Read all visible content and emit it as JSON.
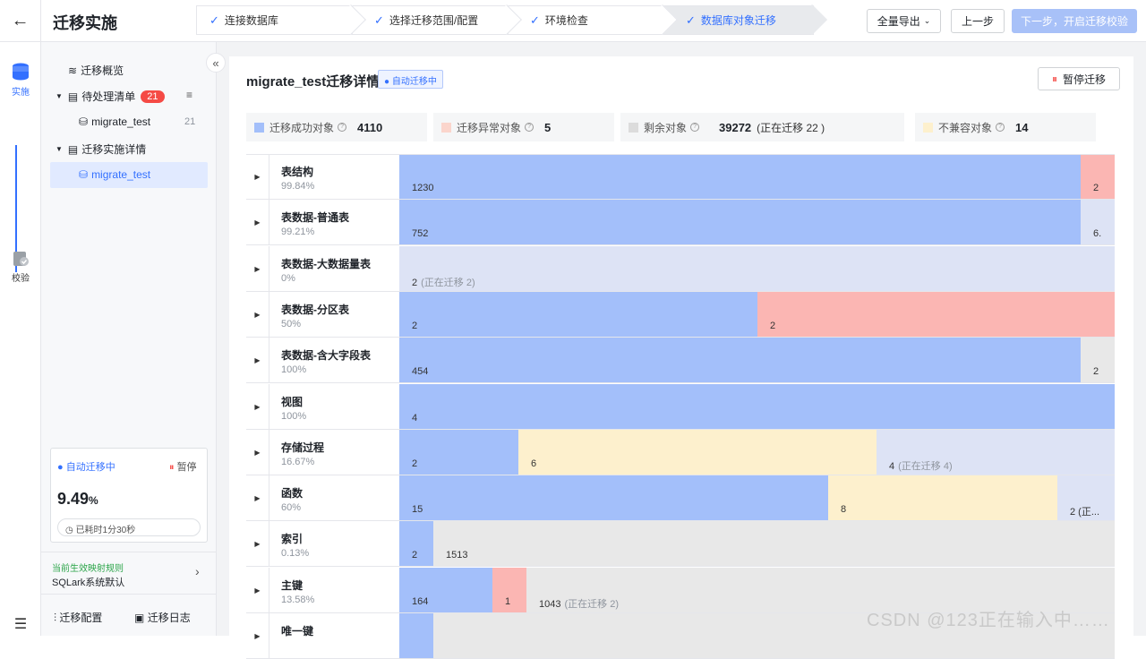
{
  "header": {
    "back_glyph": "←",
    "title": "迁移实施",
    "steps": [
      {
        "label": "连接数据库",
        "state": "done"
      },
      {
        "label": "选择迁移范围/配置",
        "state": "done"
      },
      {
        "label": "环境检查",
        "state": "done"
      },
      {
        "label": "数据库对象迁移",
        "state": "active"
      }
    ],
    "export_label": "全量导出",
    "prev_label": "上一步",
    "next_label": "下一步，开启迁移校验"
  },
  "rail": {
    "implement_label": "实施",
    "verify_label": "校验",
    "menu_icon": "menu-icon"
  },
  "sidebar": {
    "overview": "迁移概览",
    "pending": "待处理清单",
    "pending_count": "21",
    "pending_db": "migrate_test",
    "pending_db_count": "21",
    "details": "迁移实施详情",
    "details_db": "migrate_test",
    "status_label": "自动迁移中",
    "pause_label": "暂停",
    "progress_value": "9.49",
    "progress_unit": "%",
    "elapsed": "已耗时1分30秒",
    "rule_title": "当前生效映射规则",
    "rule_value": "SQLark系统默认",
    "config_label": "迁移配置",
    "log_label": "迁移日志"
  },
  "panel": {
    "title": "migrate_test迁移详情",
    "status_tag": "自动迁移中",
    "pause_button": "暂停迁移",
    "legend": [
      {
        "label": "迁移成功对象",
        "value": "4110",
        "extra": "",
        "color": "#a3bffa"
      },
      {
        "label": "迁移异常对象",
        "value": "5",
        "extra": "",
        "color": "#fbd5cc"
      },
      {
        "label": "剩余对象",
        "value": "39272",
        "extra": "(正在迁移  22 )",
        "color": "#dcdcdc"
      },
      {
        "label": "不兼容对象",
        "value": "14",
        "extra": "",
        "color": "#fdf0cd"
      }
    ]
  },
  "colors": {
    "accent": "#3370ff",
    "success": "#a3bffa",
    "error": "#fbb6b3",
    "incompatible": "#fdf0cd",
    "remaining": "#e8e8e8",
    "queued": "#dde3f5"
  },
  "rows": [
    {
      "name": "表结构",
      "pct": "99.84%",
      "segments": [
        {
          "kind": "ok",
          "frac": 0.952,
          "label": "1230"
        },
        {
          "kind": "err",
          "frac": 0.048,
          "label": "2"
        }
      ]
    },
    {
      "name": "表数据-普通表",
      "pct": "99.21%",
      "segments": [
        {
          "kind": "ok",
          "frac": 0.952,
          "label": "752"
        },
        {
          "kind": "queued",
          "frac": 0.048,
          "label": "6."
        }
      ]
    },
    {
      "name": "表数据-大数据量表",
      "pct": "0%",
      "segments": [
        {
          "kind": "queued",
          "frac": 1.0,
          "label": "2",
          "sub": "(正在迁移 2)"
        }
      ]
    },
    {
      "name": "表数据-分区表",
      "pct": "50%",
      "segments": [
        {
          "kind": "ok",
          "frac": 0.5,
          "label": "2"
        },
        {
          "kind": "err",
          "frac": 0.5,
          "label": "2"
        }
      ]
    },
    {
      "name": "表数据-含大字段表",
      "pct": "100%",
      "segments": [
        {
          "kind": "ok",
          "frac": 0.952,
          "label": "454"
        },
        {
          "kind": "rest",
          "frac": 0.048,
          "label": "2"
        }
      ]
    },
    {
      "name": "视图",
      "pct": "100%",
      "segments": [
        {
          "kind": "ok",
          "frac": 1.0,
          "label": "4"
        }
      ]
    },
    {
      "name": "存储过程",
      "pct": "16.67%",
      "segments": [
        {
          "kind": "ok",
          "frac": 0.167,
          "label": "2"
        },
        {
          "kind": "inc",
          "frac": 0.5,
          "label": "6"
        },
        {
          "kind": "queued",
          "frac": 0.333,
          "label": "4",
          "sub": "(正在迁移 4)"
        }
      ]
    },
    {
      "name": "函数",
      "pct": "60%",
      "segments": [
        {
          "kind": "ok",
          "frac": 0.6,
          "label": "15"
        },
        {
          "kind": "inc",
          "frac": 0.32,
          "label": "8"
        },
        {
          "kind": "queued",
          "frac": 0.08,
          "label": "2 (正..."
        }
      ]
    },
    {
      "name": "索引",
      "pct": "0.13%",
      "segments": [
        {
          "kind": "ok",
          "frac": 0.048,
          "label": "2"
        },
        {
          "kind": "rest",
          "frac": 0.952,
          "label": "1513"
        }
      ]
    },
    {
      "name": "主键",
      "pct": "13.58%",
      "segments": [
        {
          "kind": "ok",
          "frac": 0.13,
          "label": "164"
        },
        {
          "kind": "err",
          "frac": 0.048,
          "label": "1"
        },
        {
          "kind": "rest",
          "frac": 0.822,
          "label": "1043",
          "sub": "(正在迁移 2)"
        }
      ]
    },
    {
      "name": "唯一键",
      "pct": "",
      "segments": [
        {
          "kind": "ok",
          "frac": 0.048,
          "label": ""
        },
        {
          "kind": "rest",
          "frac": 0.952,
          "label": ""
        }
      ]
    }
  ],
  "watermark": "CSDN @123正在输入中……"
}
